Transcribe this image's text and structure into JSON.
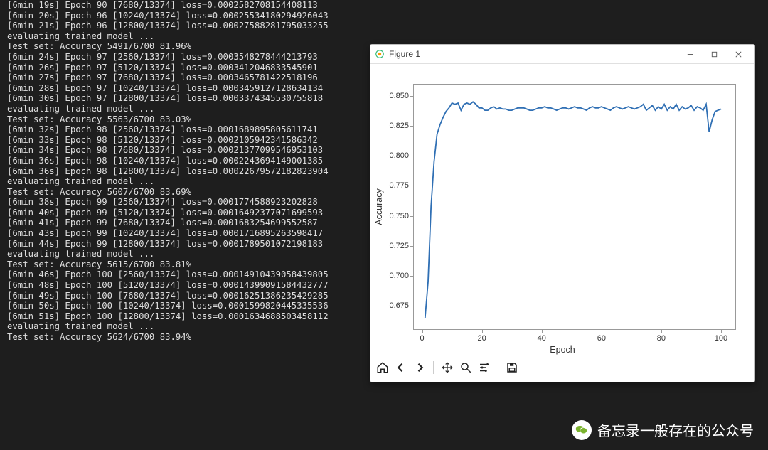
{
  "terminal": {
    "lines": [
      "[6min 19s] Epoch 90 [7680/13374] loss=0.0002582708154408113",
      "[6min 20s] Epoch 96 [10240/13374] loss=0.00025534180294926043",
      "[6min 21s] Epoch 96 [12800/13374] loss=0.00027588281795033255",
      "evaluating trained model ...",
      "Test set: Accuracy 5491/6700 81.96%",
      "[6min 24s] Epoch 97 [2560/13374] loss=0.0003548278444213793",
      "[6min 26s] Epoch 97 [5120/13374] loss=0.0003412046833545901",
      "[6min 27s] Epoch 97 [7680/13374] loss=0.0003465781422518196",
      "[6min 28s] Epoch 97 [10240/13374] loss=0.0003459127128634134",
      "[6min 30s] Epoch 97 [12800/13374] loss=0.0003374345530755818",
      "evaluating trained model ...",
      "Test set: Accuracy 5563/6700 83.03%",
      "[6min 32s] Epoch 98 [2560/13374] loss=0.0001689895805611741",
      "[6min 33s] Epoch 98 [5120/13374] loss=0.0002105942341586342",
      "[6min 34s] Epoch 98 [7680/13374] loss=0.00021377099546953103",
      "[6min 36s] Epoch 98 [10240/13374] loss=0.0002243694149001385",
      "[6min 36s] Epoch 98 [12800/13374] loss=0.00022679572182823904",
      "evaluating trained model ...",
      "Test set: Accuracy 5607/6700 83.69%",
      "[6min 38s] Epoch 99 [2560/13374] loss=0.0001774588923202828",
      "[6min 40s] Epoch 99 [5120/13374] loss=0.00016492377071699593",
      "[6min 41s] Epoch 99 [7680/13374] loss=0.0001683254699552587",
      "[6min 43s] Epoch 99 [10240/13374] loss=0.0001716895263598417",
      "[6min 44s] Epoch 99 [12800/13374] loss=0.0001789501072198183",
      "evaluating trained model ...",
      "Test set: Accuracy 5615/6700 83.81%",
      "[6min 46s] Epoch 100 [2560/13374] loss=0.00014910439058439805",
      "[6min 48s] Epoch 100 [5120/13374] loss=0.00014399091584432777",
      "[6min 49s] Epoch 100 [7680/13374] loss=0.00016251386235429285",
      "[6min 50s] Epoch 100 [10240/13374] loss=0.0001599820445335536",
      "[6min 51s] Epoch 100 [12800/13374] loss=0.0001634688503458112",
      "evaluating trained model ...",
      "Test set: Accuracy 5624/6700 83.94%"
    ]
  },
  "figure": {
    "title": "Figure 1",
    "xlabel": "Epoch",
    "ylabel": "Accuracy"
  },
  "watermark": "备忘录一般存在的公众号",
  "chart_data": {
    "type": "line",
    "title": "",
    "xlabel": "Epoch",
    "ylabel": "Accuracy",
    "xlim": [
      -3,
      105
    ],
    "ylim": [
      0.655,
      0.86
    ],
    "xticks": [
      0,
      20,
      40,
      60,
      80,
      100
    ],
    "yticks": [
      0.675,
      0.7,
      0.725,
      0.75,
      0.775,
      0.8,
      0.825,
      0.85
    ],
    "series": [
      {
        "name": "Accuracy",
        "color": "#2f6fb4",
        "x": [
          1,
          2,
          3,
          4,
          5,
          6,
          7,
          8,
          9,
          10,
          11,
          12,
          13,
          14,
          15,
          16,
          17,
          18,
          19,
          20,
          21,
          22,
          23,
          24,
          25,
          26,
          27,
          28,
          29,
          30,
          31,
          32,
          33,
          34,
          35,
          36,
          37,
          38,
          39,
          40,
          41,
          42,
          43,
          44,
          45,
          46,
          47,
          48,
          49,
          50,
          51,
          52,
          53,
          54,
          55,
          56,
          57,
          58,
          59,
          60,
          61,
          62,
          63,
          64,
          65,
          66,
          67,
          68,
          69,
          70,
          71,
          72,
          73,
          74,
          75,
          76,
          77,
          78,
          79,
          80,
          81,
          82,
          83,
          84,
          85,
          86,
          87,
          88,
          89,
          90,
          91,
          92,
          93,
          94,
          95,
          96,
          97,
          98,
          99,
          100
        ],
        "y": [
          0.665,
          0.695,
          0.758,
          0.795,
          0.818,
          0.826,
          0.832,
          0.837,
          0.84,
          0.844,
          0.843,
          0.844,
          0.838,
          0.843,
          0.844,
          0.843,
          0.845,
          0.843,
          0.84,
          0.84,
          0.838,
          0.838,
          0.84,
          0.841,
          0.839,
          0.84,
          0.839,
          0.839,
          0.838,
          0.838,
          0.839,
          0.84,
          0.84,
          0.84,
          0.839,
          0.838,
          0.838,
          0.839,
          0.84,
          0.84,
          0.841,
          0.84,
          0.84,
          0.839,
          0.838,
          0.839,
          0.84,
          0.84,
          0.839,
          0.84,
          0.841,
          0.84,
          0.84,
          0.839,
          0.838,
          0.84,
          0.841,
          0.84,
          0.84,
          0.841,
          0.84,
          0.839,
          0.838,
          0.84,
          0.841,
          0.84,
          0.839,
          0.84,
          0.841,
          0.84,
          0.839,
          0.84,
          0.841,
          0.843,
          0.838,
          0.84,
          0.842,
          0.838,
          0.841,
          0.839,
          0.843,
          0.838,
          0.841,
          0.839,
          0.843,
          0.838,
          0.841,
          0.839,
          0.84,
          0.842,
          0.838,
          0.841,
          0.84,
          0.838,
          0.843,
          0.82,
          0.83,
          0.837,
          0.838,
          0.839
        ]
      }
    ]
  }
}
